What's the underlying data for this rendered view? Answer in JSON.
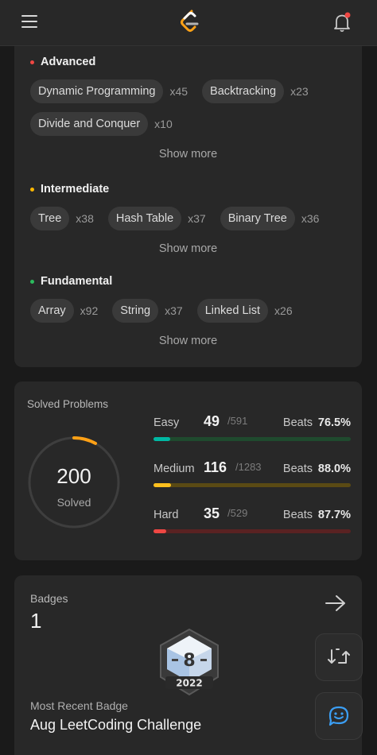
{
  "header": {
    "menu_icon": "hamburger-icon",
    "logo_icon": "leetcode-logo",
    "bell_icon": "notification-bell-icon"
  },
  "skills": {
    "advanced": {
      "title": "Advanced",
      "color": "#ef4743",
      "tags": [
        {
          "name": "Dynamic Programming",
          "count": "x45"
        },
        {
          "name": "Backtracking",
          "count": "x23"
        },
        {
          "name": "Divide and Conquer",
          "count": "x10"
        }
      ],
      "show_more": "Show more"
    },
    "intermediate": {
      "title": "Intermediate",
      "color": "#ffb800",
      "tags": [
        {
          "name": "Tree",
          "count": "x38"
        },
        {
          "name": "Hash Table",
          "count": "x37"
        },
        {
          "name": "Binary Tree",
          "count": "x36"
        }
      ],
      "show_more": "Show more"
    },
    "fundamental": {
      "title": "Fundamental",
      "color": "#2cbb5d",
      "tags": [
        {
          "name": "Array",
          "count": "x92"
        },
        {
          "name": "String",
          "count": "x37"
        },
        {
          "name": "Linked List",
          "count": "x26"
        }
      ],
      "show_more": "Show more"
    }
  },
  "solved": {
    "title": "Solved Problems",
    "total": "200",
    "total_label": "Solved",
    "ring_progress": 0.08,
    "ring_color": "#ffa116",
    "difficulties": [
      {
        "name": "Easy",
        "count": "49",
        "total": "/591",
        "beats_label": "Beats",
        "beats": "76.5%",
        "fill": 0.083,
        "color": "#00b8a3",
        "track": "#1f4a2e"
      },
      {
        "name": "Medium",
        "count": "116",
        "total": "/1283",
        "beats_label": "Beats",
        "beats": "88.0%",
        "fill": 0.09,
        "color": "#ffc01e",
        "track": "#5a4a14"
      },
      {
        "name": "Hard",
        "count": "35",
        "total": "/529",
        "beats_label": "Beats",
        "beats": "87.7%",
        "fill": 0.066,
        "color": "#ef4743",
        "track": "#5a2222"
      }
    ]
  },
  "badges": {
    "label": "Badges",
    "count": "1",
    "arrow_icon": "arrow-right-icon",
    "badge_month": "8",
    "badge_year": "2022",
    "recent_label": "Most Recent Badge",
    "recent_name": "Aug LeetCoding Challenge"
  },
  "fabs": {
    "switch_icon": "switch-view-icon",
    "chat_icon": "chat-bubble-icon"
  }
}
